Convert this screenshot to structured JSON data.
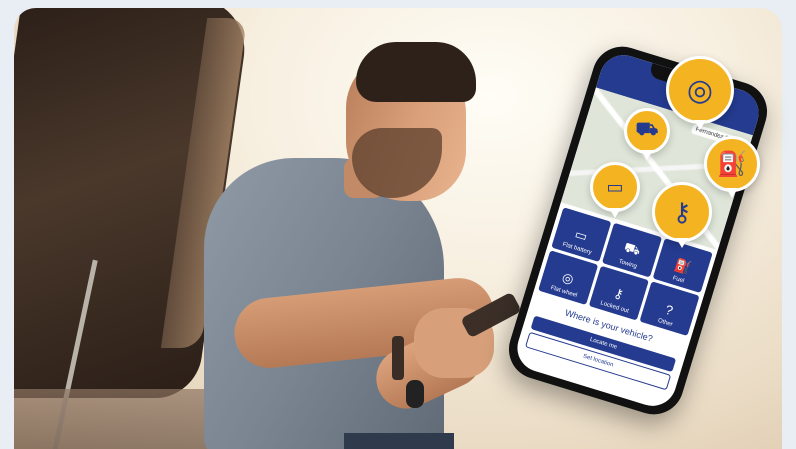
{
  "app": {
    "address_text": "Fernandez Street",
    "tiles": [
      {
        "label": "Flat battery",
        "icon": "battery-icon"
      },
      {
        "label": "Towing",
        "icon": "tow-truck-icon"
      },
      {
        "label": "Fuel",
        "icon": "fuel-icon"
      },
      {
        "label": "Flat wheel",
        "icon": "wheel-icon"
      },
      {
        "label": "Locked out",
        "icon": "key-icon"
      },
      {
        "label": "Other",
        "icon": "question-icon"
      }
    ],
    "question": "Where is your vehicle?",
    "primary_button": "Locate me",
    "secondary_button": "Set location"
  },
  "pins": {
    "tire": "tire-icon",
    "tow": "tow-truck-icon",
    "fuel": "fuel-pump-icon",
    "battery": "battery-icon",
    "key": "key-icon"
  },
  "colors": {
    "brand_blue": "#243b8f",
    "accent_yellow": "#f4b321"
  }
}
